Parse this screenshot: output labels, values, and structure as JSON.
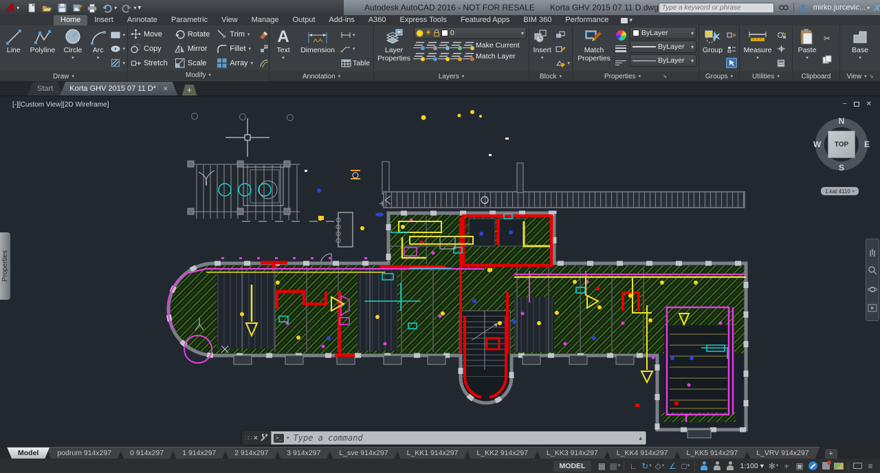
{
  "icons": {
    "chevron_down": "▾",
    "chevron_up": "▴",
    "close": "✕",
    "minimize": "−",
    "plus": "+",
    "menu": "≡",
    "grid": "▦",
    "ortho": "∟",
    "polar": "↻",
    "iso": "◇",
    "angle": "∠",
    "osnap": "□",
    "gear": "✻",
    "isolate": "▣",
    "grip": "∷∷",
    "prompt": "&gt;_",
    "text_glyph": "A",
    "cut": "✂",
    "a360": "△",
    "sun": "☀"
  },
  "title_bar": {
    "app_title": "Autodesk AutoCAD 2016 - NOT FOR RESALE",
    "doc_title": "Korta GHV 2015 07 11 D.dwg",
    "search_placeholder": "Type a keyword or phrase",
    "user_name": "mirko.jurcevic...",
    "x_logo": "X",
    "help": "?"
  },
  "ribbon": {
    "tabs": [
      {
        "label": "Home",
        "active": true
      },
      {
        "label": "Insert"
      },
      {
        "label": "Annotate"
      },
      {
        "label": "Parametric"
      },
      {
        "label": "View"
      },
      {
        "label": "Manage"
      },
      {
        "label": "Output"
      },
      {
        "label": "Add-ins"
      },
      {
        "label": "A360"
      },
      {
        "label": "Express Tools"
      },
      {
        "label": "Featured Apps"
      },
      {
        "label": "BIM 360"
      },
      {
        "label": "Performance"
      }
    ],
    "draw": {
      "label": "Draw",
      "line": "Line",
      "polyline": "Polyline",
      "circle": "Circle",
      "arc": "Arc"
    },
    "modify": {
      "label": "Modify",
      "move": "Move",
      "rotate": "Rotate",
      "trim": "Trim",
      "copy": "Copy",
      "mirror": "Mirror",
      "fillet": "Fillet",
      "stretch": "Stretch",
      "scale": "Scale",
      "array": "Array"
    },
    "annotation": {
      "label": "Annotation",
      "text": "Text",
      "dimension": "Dimension",
      "table": "Table"
    },
    "layers": {
      "label": "Layers",
      "layer_properties_1": "Layer",
      "layer_properties_2": "Properties",
      "current_layer": "0",
      "make_current": "Make Current",
      "match_layer": "Match Layer"
    },
    "block": {
      "label": "Block",
      "insert": "Insert"
    },
    "properties": {
      "label": "Properties",
      "match_properties_1": "Match",
      "match_properties_2": "Properties",
      "color": "ByLayer",
      "lineweight": "ByLayer",
      "linetype": "ByLayer"
    },
    "groups": {
      "label": "Groups",
      "group": "Group"
    },
    "utilities": {
      "label": "Utilities",
      "measure": "Measure"
    },
    "clipboard": {
      "label": "Clipboard",
      "paste": "Paste"
    },
    "view": {
      "label": "View",
      "base": "Base"
    }
  },
  "file_tabs": {
    "tabs": [
      {
        "label": "Start"
      },
      {
        "label": "Korta GHV 2015 07 11 D*",
        "active": true
      }
    ]
  },
  "viewport": {
    "label": "[-][Custom View][2D Wireframe]",
    "viewcube": {
      "n": "N",
      "s": "S",
      "e": "E",
      "w": "W",
      "top": "TOP"
    },
    "view_pill": "1.kat 4110",
    "properties_palette": "Properties"
  },
  "command_line": {
    "placeholder": "Type a command"
  },
  "layout_tabs": {
    "tabs": [
      {
        "label": "Model",
        "active": true
      },
      {
        "label": "podrum 914x297"
      },
      {
        "label": "0 914x297"
      },
      {
        "label": "1 914x297"
      },
      {
        "label": "2 914x297"
      },
      {
        "label": "3 914x297"
      },
      {
        "label": "L_sve 914x297"
      },
      {
        "label": "L_KK1 914x297"
      },
      {
        "label": "L_KK2 914x297"
      },
      {
        "label": "L_KK3 914x297"
      },
      {
        "label": "L_KK4 914x297"
      },
      {
        "label": "L_KK5 914x297"
      },
      {
        "label": "L_VRV 914x297"
      }
    ]
  },
  "status_bar": {
    "model": "MODEL",
    "scale": "1:100"
  },
  "colors": {
    "canvas_bg": "#212830",
    "hatch_green": "#47942a",
    "wall_gray": "#7a8086",
    "accent_red": "#e60000",
    "accent_magenta": "#e33de3",
    "accent_yellow": "#f0e130",
    "accent_cyan": "#19d2d2"
  }
}
